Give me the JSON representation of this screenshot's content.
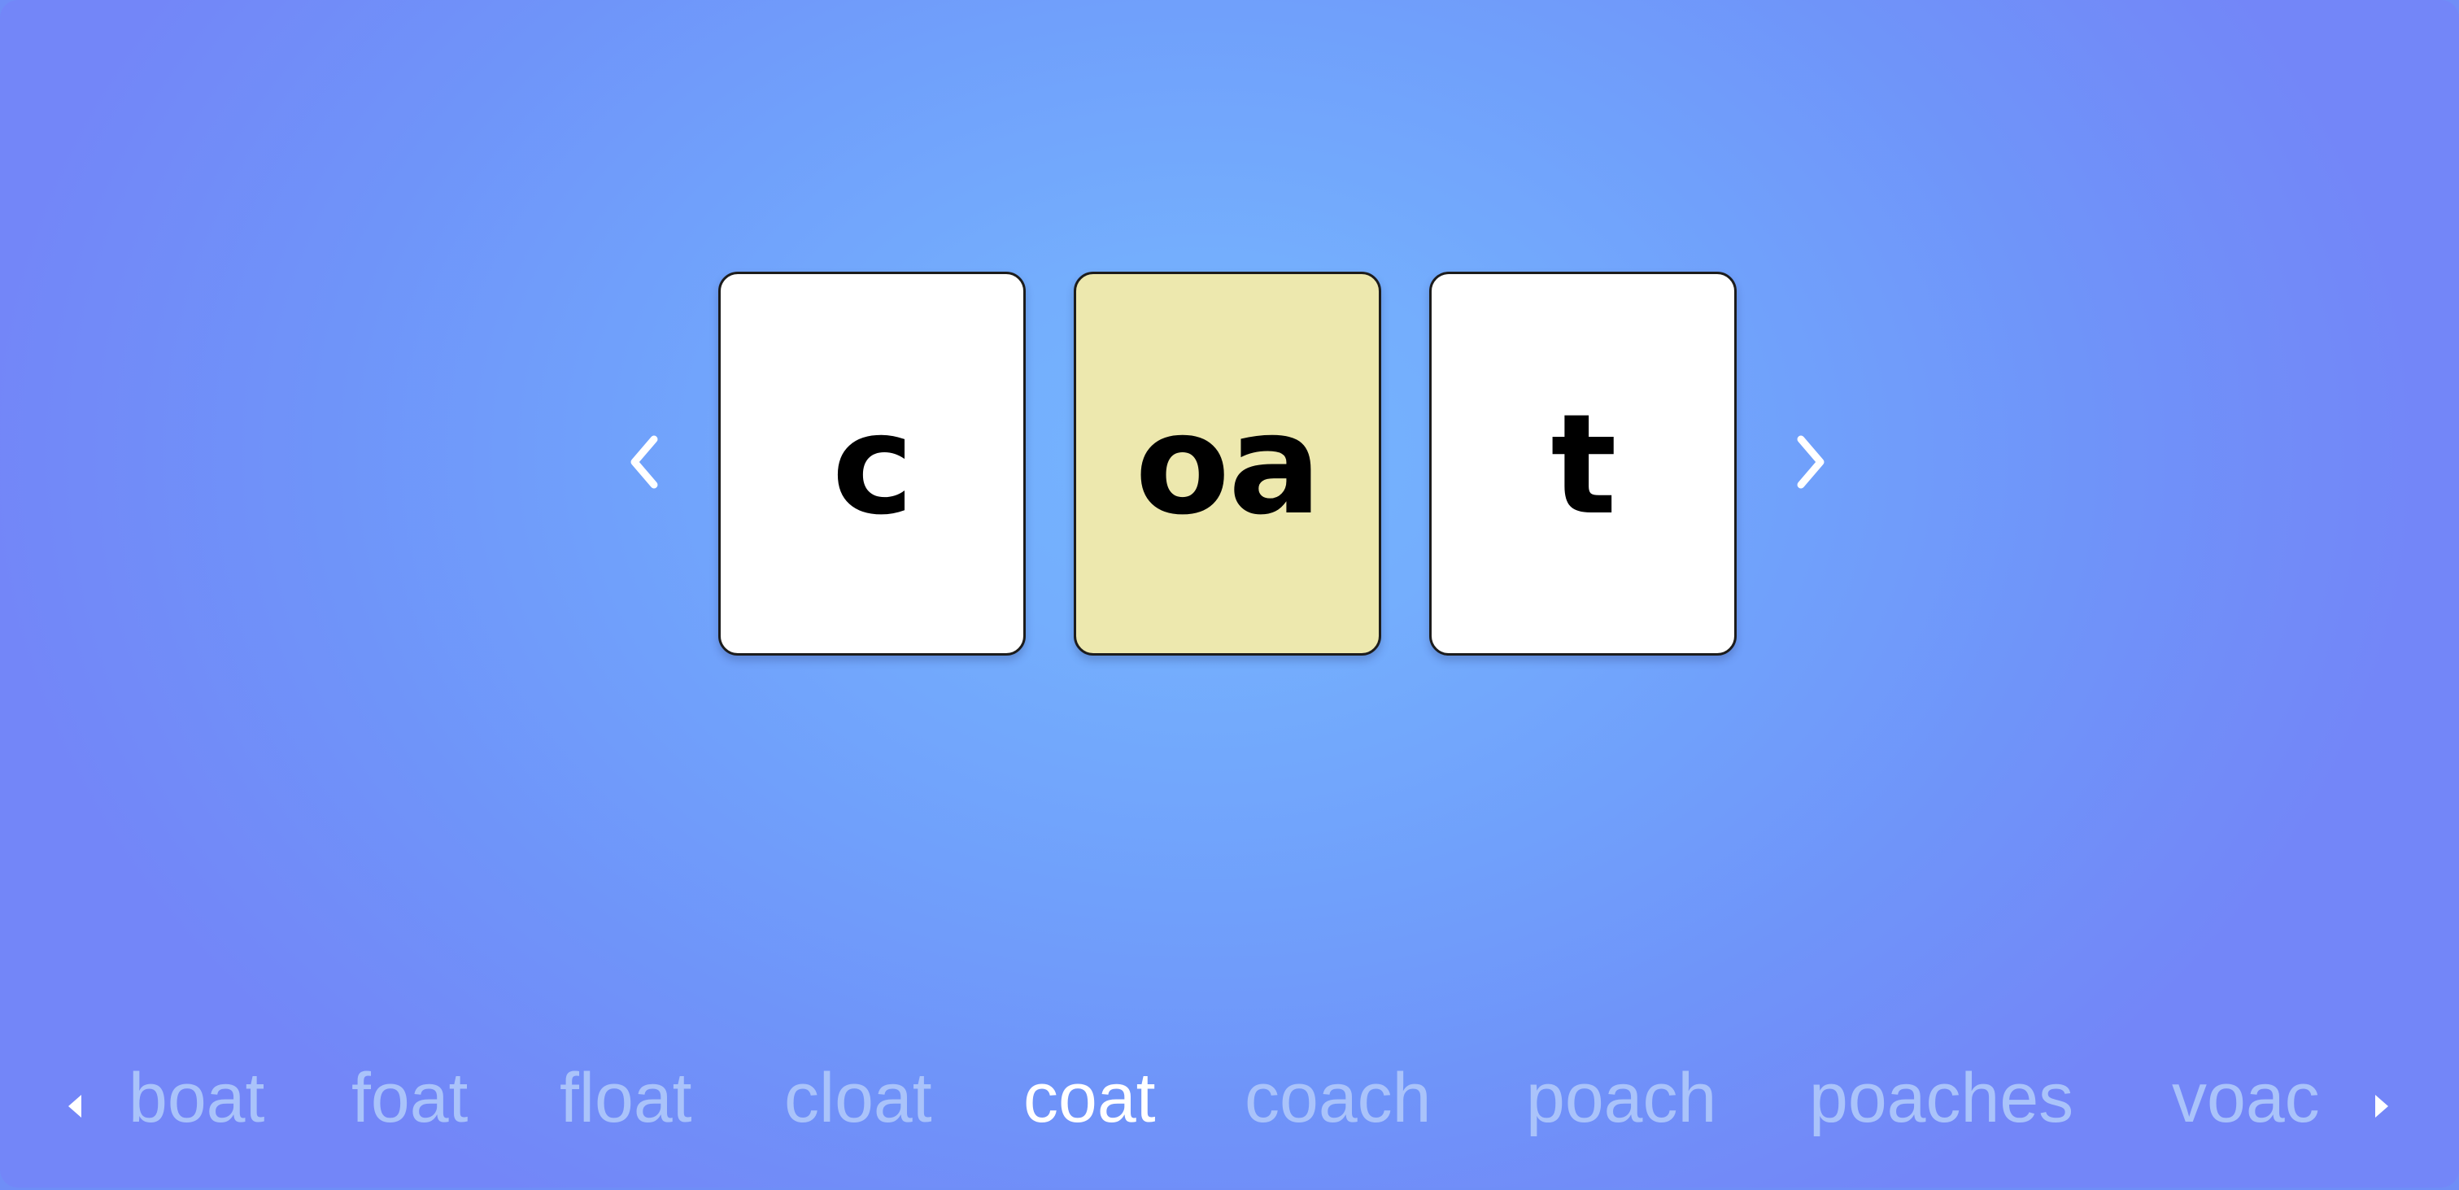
{
  "cards": [
    {
      "letter": "c",
      "highlighted": false
    },
    {
      "letter": "oa",
      "highlighted": true
    },
    {
      "letter": "t",
      "highlighted": false
    }
  ],
  "navigation": {
    "prev_icon": "chevron-left-icon",
    "next_icon": "chevron-right-icon"
  },
  "word_strip": {
    "words": [
      "boat",
      "foat",
      "float",
      "cloat",
      "coat",
      "coach",
      "poach",
      "poaches",
      "voac"
    ],
    "active_word": "coat",
    "prev_icon": "triangle-left-icon",
    "next_icon": "triangle-right-icon"
  },
  "colors": {
    "background": "#74aefd",
    "card": "#ffffff",
    "card_highlight": "#ede8ae",
    "word_inactive": "#aac3fa",
    "word_active": "#ffffff"
  }
}
